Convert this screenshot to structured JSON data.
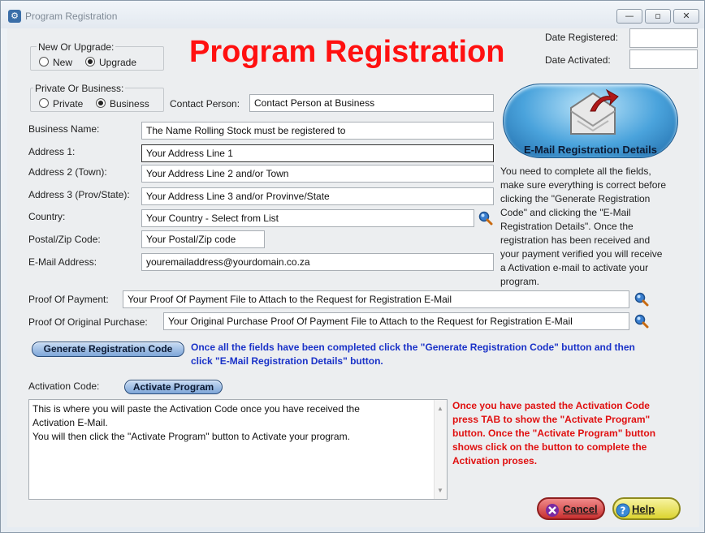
{
  "window": {
    "title": "Program Registration",
    "controls": {
      "minimize": "—",
      "restore": "▫",
      "close": "✕"
    }
  },
  "header": {
    "title": "Program Registration"
  },
  "new_or_upgrade": {
    "legend": "New Or Upgrade:",
    "options": [
      {
        "label": "New",
        "selected": false
      },
      {
        "label": "Upgrade",
        "selected": true
      }
    ]
  },
  "private_or_business": {
    "legend": "Private Or Business:",
    "options": [
      {
        "label": "Private",
        "selected": false
      },
      {
        "label": "Business",
        "selected": true
      }
    ]
  },
  "dates": {
    "registered_label": "Date Registered:",
    "registered_value": "",
    "activated_label": "Date Activated:",
    "activated_value": ""
  },
  "form": {
    "contact_person": {
      "label": "Contact Person:",
      "value": "Contact Person at Business"
    },
    "business_name": {
      "label": "Business Name:",
      "value": "The Name Rolling Stock must be registered to"
    },
    "address1": {
      "label": "Address 1:",
      "value": "Your Address Line 1"
    },
    "address2": {
      "label": "Address 2 (Town):",
      "value": "Your Address Line 2 and/or Town"
    },
    "address3": {
      "label": "Address 3 (Prov/State):",
      "value": "Your Address Line 3 and/or Provinve/State"
    },
    "country": {
      "label": "Country:",
      "value": "Your Country - Select from List"
    },
    "postal": {
      "label": "Postal/Zip Code:",
      "value": "Your Postal/Zip code"
    },
    "email": {
      "label": "E-Mail Address:",
      "value": "youremailaddress@yourdomain.co.za"
    },
    "proof_payment": {
      "label": "Proof Of Payment:",
      "value": "Your Proof Of Payment File to Attach to the Request for Registration E-Mail"
    },
    "proof_purchase": {
      "label": "Proof Of Original Purchase:",
      "value": "Your Original Purchase Proof Of Payment File to Attach to the Request for Registration E-Mail"
    }
  },
  "email_panel": {
    "button_label": "E-Mail Registration Details",
    "instructions": [
      "You need to complete all the fields,",
      "make sure everything is correct before",
      "clicking the \"Generate Registration",
      "Code\" and clicking the \"E-Mail",
      "Registration Details\". Once the",
      "registration has been received and",
      "your payment verified you will receive",
      "a Activation e-mail to activate your",
      "program."
    ]
  },
  "generate": {
    "button_label": "Generate Registration Code",
    "note_line1": "Once all the fields have been completed click the \"Generate Registration Code\" button and then",
    "note_line2": "click \"E-Mail Registration Details\" button."
  },
  "activation": {
    "label": "Activation Code:",
    "button_label": "Activate Program",
    "text_lines": [
      "This is where you will paste the Activation Code once you have received the",
      "Activation E-Mail.",
      "You will then click the \"Activate Program\" button to Activate your program."
    ],
    "note_lines": [
      "Once you have pasted the Activation Code",
      "press TAB to show the \"Activate Program\"",
      "button. Once the \"Activate Program\" button",
      "shows click on the button to complete the",
      "Activation proses."
    ]
  },
  "footer": {
    "cancel_label": "Cancel",
    "help_label": "Help"
  },
  "colors": {
    "title_red": "#ff1010",
    "note_blue": "#1a32c8",
    "note_red": "#e01010",
    "cancel": "#d23a3a",
    "help": "#e6e040"
  }
}
